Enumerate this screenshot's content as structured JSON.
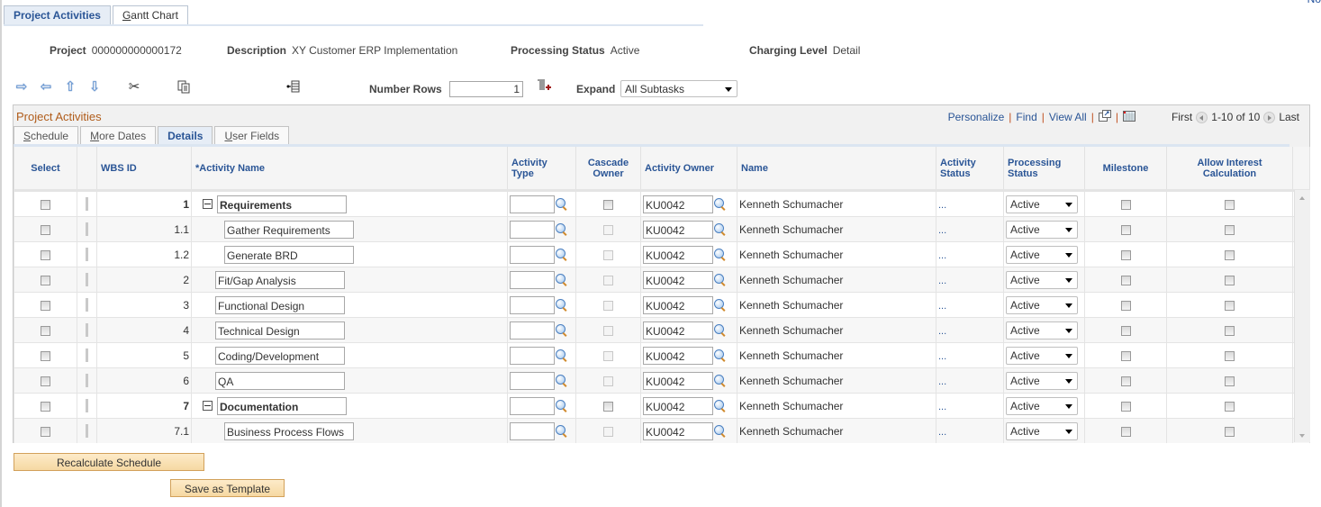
{
  "corner_link": "No",
  "top_tabs": [
    {
      "label": "Project Activities",
      "active": true
    },
    {
      "label_pre": "",
      "label_ul": "G",
      "label_post": "antt Chart",
      "active": false
    }
  ],
  "header": {
    "project_label": "Project",
    "project_value": "000000000000172",
    "description_label": "Description",
    "description_value": "XY Customer ERP Implementation",
    "processing_status_label": "Processing Status",
    "processing_status_value": "Active",
    "charging_level_label": "Charging Level",
    "charging_level_value": "Detail"
  },
  "toolbar": {
    "icons": [
      "indent-right-icon",
      "outdent-left-icon",
      "move-up-icon",
      "move-down-icon",
      "cut-icon",
      "paste-icon",
      "insert-row-icon"
    ],
    "number_rows_label": "Number Rows",
    "number_rows_value": "1",
    "expand_label": "Expand",
    "expand_value": "All Subtasks"
  },
  "grid": {
    "title": "Project Activities",
    "nav": {
      "personalize": "Personalize",
      "find": "Find",
      "view_all": "View All",
      "first": "First",
      "range": "1-10 of 10",
      "last": "Last"
    },
    "sub_tabs": [
      {
        "ul": "S",
        "rest": "chedule",
        "active": false
      },
      {
        "ul": "M",
        "rest": "ore Dates",
        "active": false
      },
      {
        "ul": "",
        "rest": "Details",
        "active": true
      },
      {
        "ul": "U",
        "rest": "ser Fields",
        "active": false
      }
    ],
    "columns": {
      "select": "Select",
      "wbs_id": "WBS ID",
      "activity_name": "*Activity Name",
      "activity_type": "Activity Type",
      "cascade_owner": "Cascade Owner",
      "activity_owner": "Activity Owner",
      "name": "Name",
      "activity_status": "Activity Status",
      "processing_status": "Processing Status",
      "milestone": "Milestone",
      "allow_interest": "Allow Interest Calculation"
    },
    "rows": [
      {
        "wbs": "1",
        "name": "Requirements",
        "level": 0,
        "parent": true,
        "activity_type": "",
        "owner": "KU0042",
        "owner_name": "Kenneth Schumacher",
        "status": "...",
        "processing_status": "Active"
      },
      {
        "wbs": "1.1",
        "name": "Gather Requirements",
        "level": 1,
        "parent": false,
        "activity_type": "",
        "owner": "KU0042",
        "owner_name": "Kenneth Schumacher",
        "status": "...",
        "processing_status": "Active"
      },
      {
        "wbs": "1.2",
        "name": "Generate BRD",
        "level": 1,
        "parent": false,
        "activity_type": "",
        "owner": "KU0042",
        "owner_name": "Kenneth Schumacher",
        "status": "...",
        "processing_status": "Active"
      },
      {
        "wbs": "2",
        "name": "Fit/Gap Analysis",
        "level": 0,
        "parent": false,
        "activity_type": "",
        "owner": "KU0042",
        "owner_name": "Kenneth Schumacher",
        "status": "...",
        "processing_status": "Active"
      },
      {
        "wbs": "3",
        "name": "Functional Design",
        "level": 0,
        "parent": false,
        "activity_type": "",
        "owner": "KU0042",
        "owner_name": "Kenneth Schumacher",
        "status": "...",
        "processing_status": "Active"
      },
      {
        "wbs": "4",
        "name": "Technical Design",
        "level": 0,
        "parent": false,
        "activity_type": "",
        "owner": "KU0042",
        "owner_name": "Kenneth Schumacher",
        "status": "...",
        "processing_status": "Active"
      },
      {
        "wbs": "5",
        "name": "Coding/Development",
        "level": 0,
        "parent": false,
        "activity_type": "",
        "owner": "KU0042",
        "owner_name": "Kenneth Schumacher",
        "status": "...",
        "processing_status": "Active"
      },
      {
        "wbs": "6",
        "name": "QA",
        "level": 0,
        "parent": false,
        "activity_type": "",
        "owner": "KU0042",
        "owner_name": "Kenneth Schumacher",
        "status": "...",
        "processing_status": "Active"
      },
      {
        "wbs": "7",
        "name": "Documentation",
        "level": 0,
        "parent": true,
        "activity_type": "",
        "owner": "KU0042",
        "owner_name": "Kenneth Schumacher",
        "status": "...",
        "processing_status": "Active"
      },
      {
        "wbs": "7.1",
        "name": "Business Process Flows",
        "level": 1,
        "parent": false,
        "activity_type": "",
        "owner": "KU0042",
        "owner_name": "Kenneth Schumacher",
        "status": "...",
        "processing_status": "Active"
      }
    ]
  },
  "buttons": {
    "recalculate": "Recalculate Schedule",
    "save_template": "Save as Template"
  }
}
